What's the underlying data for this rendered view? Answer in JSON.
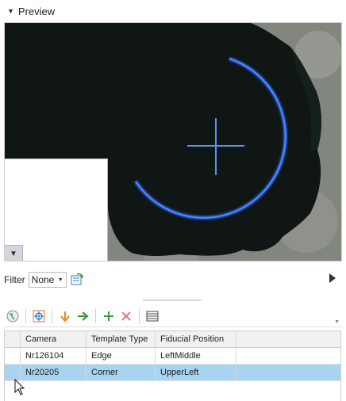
{
  "preview": {
    "title": "Preview",
    "collapse_icon": "chevron-down-icon",
    "overview_toggle_icon": "triangle-down-icon"
  },
  "filter": {
    "label": "Filter",
    "selected": "None",
    "refresh_icon": "refresh-icon",
    "play_icon": "play-icon"
  },
  "toolbar": {
    "buttons": [
      {
        "icon": "globe-icon"
      },
      {
        "icon": "crosshair-target-icon"
      },
      {
        "icon": "arrow-down-icon",
        "color": "#e8902a"
      },
      {
        "icon": "arrow-right-icon",
        "color": "#3a9b3a"
      },
      {
        "icon": "add-icon",
        "color": "#3a9b3a"
      },
      {
        "icon": "delete-icon",
        "color": "#e07b7b"
      },
      {
        "icon": "table-icon"
      }
    ]
  },
  "table": {
    "columns": [
      "Camera",
      "Template Type",
      "Fiducial Position"
    ],
    "rows": [
      {
        "camera": "Nr126104",
        "template_type": "Edge",
        "fiducial_position": "LeftMiddle",
        "selected": false
      },
      {
        "camera": "Nr20205",
        "template_type": "Corner",
        "fiducial_position": "UpperLeft",
        "selected": true
      }
    ]
  },
  "colors": {
    "selection": "#a8d4f2",
    "fiducial_ring": "#2f6bff"
  }
}
